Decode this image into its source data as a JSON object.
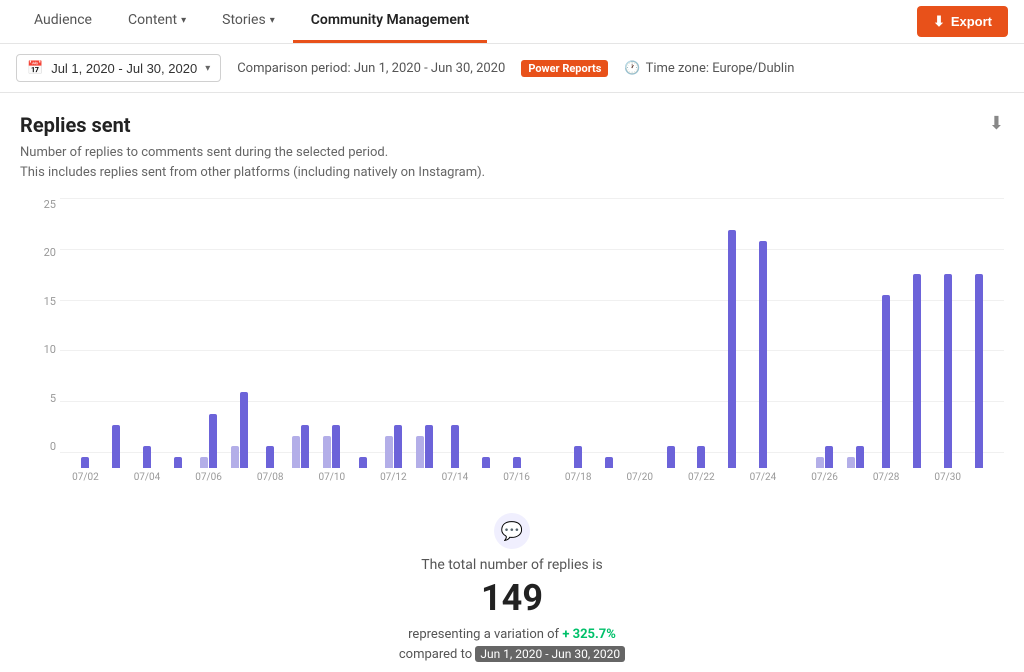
{
  "nav": {
    "tabs": [
      {
        "label": "Audience",
        "active": false,
        "has_chevron": false
      },
      {
        "label": "Content",
        "active": false,
        "has_chevron": true
      },
      {
        "label": "Stories",
        "active": false,
        "has_chevron": true
      },
      {
        "label": "Community Management",
        "active": true,
        "has_chevron": false
      }
    ],
    "export_label": "Export"
  },
  "filter_bar": {
    "date_range": "Jul 1, 2020 - Jul 30, 2020",
    "comparison_label": "Comparison period: Jun 1, 2020 - Jun 30, 2020",
    "power_reports_label": "Power Reports",
    "timezone_label": "Time zone: Europe/Dublin"
  },
  "chart": {
    "title": "Replies sent",
    "description_line1": "Number of replies to comments sent during the selected period.",
    "description_line2": "This includes replies sent from other platforms (including natively on Instagram).",
    "y_axis_labels": [
      "25",
      "20",
      "15",
      "10",
      "5",
      "0"
    ],
    "x_axis_labels": [
      "07/02",
      "07/04",
      "07/06",
      "07/08",
      "07/10",
      "07/12",
      "07/14",
      "07/16",
      "07/18",
      "07/20",
      "07/22",
      "07/24",
      "07/26",
      "07/28",
      "07/30"
    ],
    "bars": [
      {
        "main": 1,
        "comp": 0
      },
      {
        "main": 4,
        "comp": 0
      },
      {
        "main": 2,
        "comp": 0
      },
      {
        "main": 1,
        "comp": 0
      },
      {
        "main": 5,
        "comp": 1
      },
      {
        "main": 7,
        "comp": 2
      },
      {
        "main": 2,
        "comp": 0
      },
      {
        "main": 4,
        "comp": 3
      },
      {
        "main": 4,
        "comp": 3
      },
      {
        "main": 1,
        "comp": 0
      },
      {
        "main": 4,
        "comp": 3
      },
      {
        "main": 4,
        "comp": 3
      },
      {
        "main": 4,
        "comp": 0
      },
      {
        "main": 1,
        "comp": 0
      },
      {
        "main": 1,
        "comp": 0
      },
      {
        "main": 0,
        "comp": 0
      },
      {
        "main": 2,
        "comp": 0
      },
      {
        "main": 1,
        "comp": 0
      },
      {
        "main": 0,
        "comp": 0
      },
      {
        "main": 2,
        "comp": 0
      },
      {
        "main": 2,
        "comp": 0
      },
      {
        "main": 22,
        "comp": 0
      },
      {
        "main": 21,
        "comp": 0
      },
      {
        "main": 0,
        "comp": 0
      },
      {
        "main": 2,
        "comp": 1
      },
      {
        "main": 2,
        "comp": 1
      },
      {
        "main": 16,
        "comp": 0
      },
      {
        "main": 18,
        "comp": 0
      },
      {
        "main": 18,
        "comp": 0
      },
      {
        "main": 18,
        "comp": 0
      }
    ],
    "max_value": 25
  },
  "summary": {
    "total_label": "The total number of replies is",
    "total_value": "149",
    "variation_prefix": "representing a variation of",
    "variation_value": "+ 325.7%",
    "compared_prefix": "compared to",
    "compared_period": "Jun 1, 2020 - Jun 30, 2020"
  }
}
